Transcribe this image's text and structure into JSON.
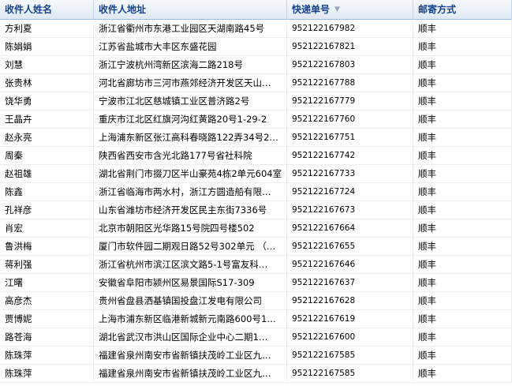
{
  "columns": {
    "name": "收件人姓名",
    "address": "收件人地址",
    "tracking": "快递单号",
    "shipping": "邮寄方式"
  },
  "rows": [
    {
      "name": "方利夏",
      "address": "浙江省衢州市东港工业园区天湖南路45号",
      "tracking": "952122167982",
      "shipping": "顺丰"
    },
    {
      "name": "陈娟娟",
      "address": "江苏省盐城市大丰区东盛花园",
      "tracking": "952122167821",
      "shipping": "顺丰"
    },
    {
      "name": "刘慧",
      "address": "浙江宁波杭州湾新区滨海二路218号",
      "tracking": "952122167803",
      "shipping": "顺丰"
    },
    {
      "name": "张贵林",
      "address": "河北省廊坊市三河市燕郊经济开发区天山…",
      "tracking": "952122167788",
      "shipping": "顺丰"
    },
    {
      "name": "饶华勇",
      "address": "宁波市江北区慈城镇工业区普济路2号",
      "tracking": "952122167779",
      "shipping": "顺丰"
    },
    {
      "name": "王晶卉",
      "address": "重庆市江北区红旗河沟红黄路20号1-29-2",
      "tracking": "952122167760",
      "shipping": "顺丰"
    },
    {
      "name": "赵永亮",
      "address": "上海浦东新区张江高科春晓路122弄34号2…",
      "tracking": "952122167751",
      "shipping": "顺丰"
    },
    {
      "name": "周秦",
      "address": "陕西省西安市含光北路177号省社科院",
      "tracking": "952122167742",
      "shipping": "顺丰"
    },
    {
      "name": "赵祖雄",
      "address": "湖北省荆门市掇刀区半山豪苑4栋2单元604室",
      "tracking": "952122167733",
      "shipping": "顺丰"
    },
    {
      "name": "陈鑫",
      "address": "浙江省临海市两水村，浙江方圆造船有限…",
      "tracking": "952122167724",
      "shipping": "顺丰"
    },
    {
      "name": "孔祥彦",
      "address": "山东省潍坊市经济开发区民主东街7336号",
      "tracking": "952122167673",
      "shipping": "顺丰"
    },
    {
      "name": "肖宏",
      "address": "北京市朝阳区光华路15号院四号楼502",
      "tracking": "952122167664",
      "shipping": "顺丰"
    },
    {
      "name": "鲁洪梅",
      "address": "厦门市软件园二期观日路52号302单元 （…",
      "tracking": "952122167655",
      "shipping": "顺丰"
    },
    {
      "name": "蒋利强",
      "address": "浙江省杭州市滨江区滨文路5-1号富友科…",
      "tracking": "952122167646",
      "shipping": "顺丰"
    },
    {
      "name": "江曙",
      "address": "安徽省阜阳市颍州区易景国际S17-309",
      "tracking": "952122167637",
      "shipping": "顺丰"
    },
    {
      "name": "高彦杰",
      "address": "贵州省盘县洒基镇国投盘江发电有限公司",
      "tracking": "952122167628",
      "shipping": "顺丰"
    },
    {
      "name": "贾博妮",
      "address": "上海市浦东新区临港新城新元南路600号1…",
      "tracking": "952122167619",
      "shipping": "顺丰"
    },
    {
      "name": "路苍海",
      "address": "湖北省武汉市洪山区国际企业中心二期1…",
      "tracking": "952122167600",
      "shipping": "顺丰"
    },
    {
      "name": "陈珠萍",
      "address": "福建省泉州南安市省新镇扶茂岭工业区九…",
      "tracking": "952122167585",
      "shipping": "顺丰"
    },
    {
      "name": "陈珠萍",
      "address": "福建省泉州南安市省新镇扶茂岭工业区九…",
      "tracking": "952122167585",
      "shipping": "顺丰"
    }
  ],
  "icons": {
    "sort": "sort-desc-icon"
  }
}
